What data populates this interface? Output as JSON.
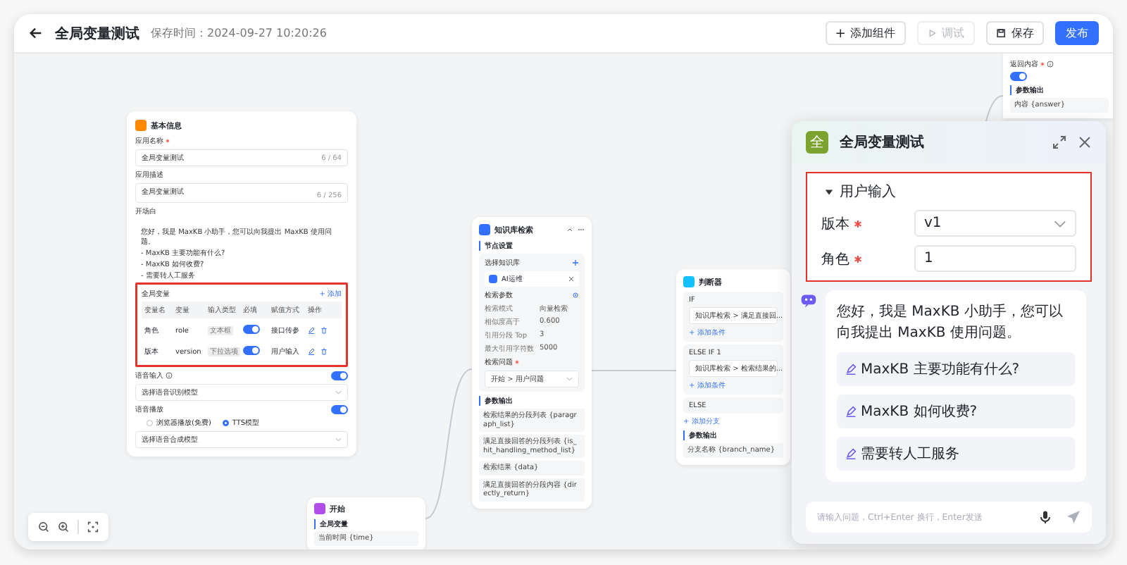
{
  "header": {
    "title": "全局变量测试",
    "save_time": "保存时间：2024-09-27 10:20:26",
    "buttons": [
      {
        "label": "添加组件",
        "kind": "add",
        "disabled": false
      },
      {
        "label": "调试",
        "kind": "debug",
        "disabled": true
      },
      {
        "label": "保存",
        "kind": "save",
        "disabled": false
      },
      {
        "label": "发布",
        "kind": "publish",
        "disabled": false
      }
    ]
  },
  "app_node": {
    "title": "基本信息",
    "name_field": {
      "label": "应用名称",
      "required": true,
      "value": "全局变量测试",
      "count": "6 / 64"
    },
    "desc_field": {
      "label": "应用描述",
      "value": "全局变量测试",
      "count": "6 / 256"
    },
    "prologue": {
      "label": "开场白",
      "lines": [
        "您好，我是 MaxKB 小助手，您可以向我提出 MaxKB 使用问题。",
        "- MaxKB 主要功能有什么?",
        "- MaxKB 如何收费?",
        "- 需要转人工服务"
      ]
    },
    "global_vars": {
      "title": "全局变量",
      "add": "+ 添加",
      "highlighted": true,
      "columns": [
        "变量名",
        "变量",
        "输入类型",
        "必填",
        "赋值方式",
        "操作"
      ],
      "rows": [
        {
          "name": "角色",
          "field": "role",
          "input_type": "文本框",
          "on": true,
          "assign": "接口传参"
        },
        {
          "name": "版本",
          "field": "version",
          "input_type": "下拉选项",
          "on": true,
          "assign": "用户输入"
        }
      ]
    },
    "voice_input": {
      "label": "语音输入",
      "on": true,
      "placeholder": "选择语音识别模型"
    },
    "voice_play": {
      "label": "语音播放",
      "on": true,
      "options": [
        {
          "label": "浏览器播放(免费)",
          "selected": false
        },
        {
          "label": "TTS模型",
          "selected": true
        }
      ],
      "placeholder": "选择语音合成模型"
    }
  },
  "kb_node": {
    "title": "知识库检索",
    "settings_title": "节点设置",
    "kb_label": "选择知识库",
    "kb_chip": "AI运维",
    "params_title": "检索参数",
    "params": [
      {
        "label": "检索模式",
        "value": "向量检索"
      },
      {
        "label": "相似度高于",
        "value": "0.600"
      },
      {
        "label": "引用分段 Top",
        "value": "3"
      },
      {
        "label": "最大引用字符数",
        "value": "5000"
      }
    ],
    "question_label": "检索问题",
    "question_required": true,
    "question_value": "开始 > 用户问题",
    "output_title": "参数输出",
    "outputs": [
      "检索结果的分段列表 {paragraph_list}",
      "满足直接回答的分段列表 {is_hit_handling_method_list}",
      "检索结果 {data}",
      "满足直接回答的分段内容 {directly_return}"
    ]
  },
  "judge_node": {
    "title": "判断器",
    "branches": [
      {
        "label": "IF",
        "condition": "知识库检索 > 满足直接回...",
        "add": "+ 添加条件"
      },
      {
        "label": "ELSE IF 1",
        "condition": "知识库检索 > 检索结果的...",
        "add": "+ 添加条件"
      },
      {
        "label": "ELSE"
      }
    ],
    "add_branch": "+ 添加分支",
    "output_title": "参数输出",
    "outputs": [
      "分支名称 {branch_name}"
    ]
  },
  "start_node": {
    "title": "开始",
    "section": "全局变量",
    "outputs": [
      "当前时间 {time}"
    ]
  },
  "reply_node": {
    "return_label": "返回内容",
    "required": true,
    "return_on": true,
    "output_title": "参数输出",
    "outputs": [
      "内容 {answer}"
    ]
  },
  "chat": {
    "avatar": "全",
    "title": "全局变量测试",
    "form": {
      "heading": "用户输入",
      "expanded": true,
      "highlighted": true,
      "fields": [
        {
          "label": "版本",
          "required": true,
          "kind": "select",
          "value": "v1"
        },
        {
          "label": "角色",
          "required": true,
          "kind": "input",
          "value": "1"
        }
      ]
    },
    "greeting": "您好，我是 MaxKB 小助手，您可以向我提出 MaxKB 使用问题。",
    "suggestions": [
      "MaxKB 主要功能有什么?",
      "MaxKB 如何收费?",
      "需要转人工服务"
    ],
    "input": {
      "placeholder": "请输入问题，Ctrl+Enter 换行，Enter发送"
    }
  }
}
